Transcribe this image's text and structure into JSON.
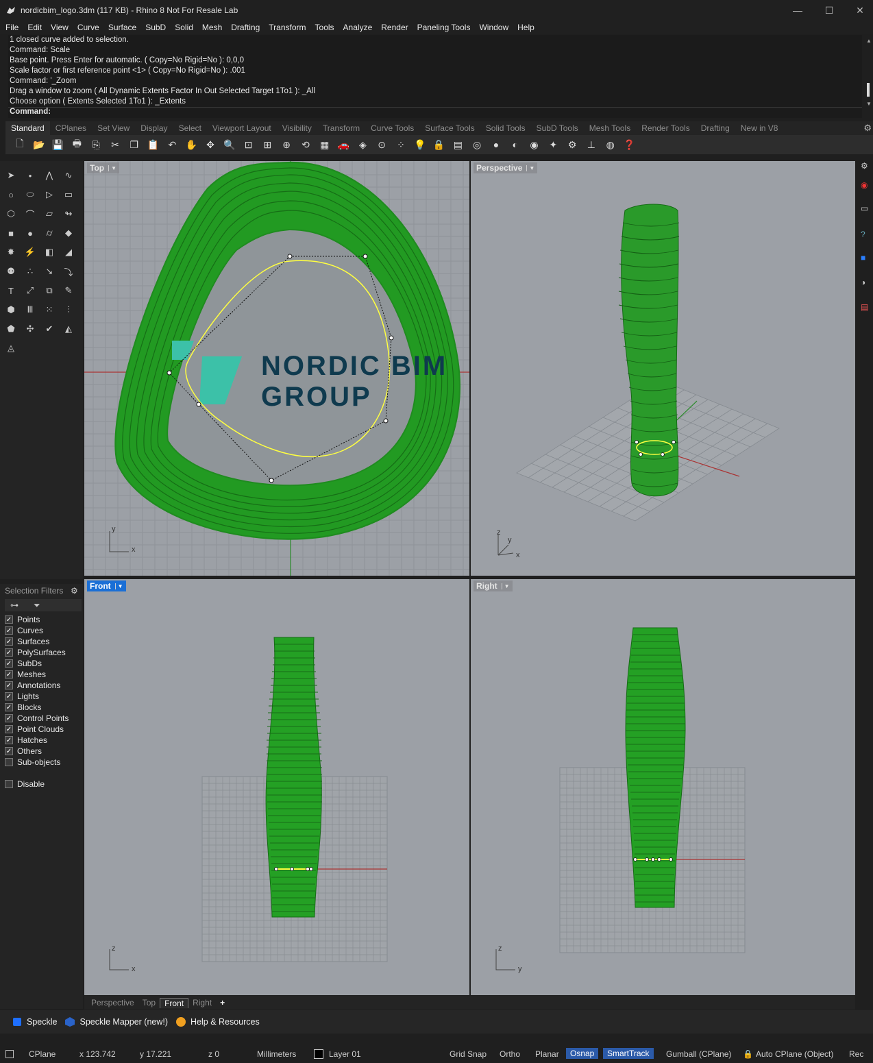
{
  "window": {
    "title": "nordicbim_logo.3dm (117 KB) - Rhino 8 Not For Resale Lab",
    "minimize": "—",
    "maximize": "☐",
    "close": "✕"
  },
  "menu": [
    "File",
    "Edit",
    "View",
    "Curve",
    "Surface",
    "SubD",
    "Solid",
    "Mesh",
    "Drafting",
    "Transform",
    "Tools",
    "Analyze",
    "Render",
    "Paneling Tools",
    "Window",
    "Help"
  ],
  "command_history": [
    "1 closed curve added to selection.",
    "Command: Scale",
    "Base point. Press Enter for automatic. ( Copy=No  Rigid=No ): 0,0,0",
    "Scale factor or first reference point <1> ( Copy=No  Rigid=No ): .001",
    "Command: '_Zoom",
    "Drag a window to zoom ( All  Dynamic  Extents  Factor  In  Out  Selected  Target  1To1 ): _All",
    "Choose option ( Extents  Selected  1To1 ): _Extents"
  ],
  "command_prompt": "Command:",
  "toolbar_tabs": [
    "Standard",
    "CPlanes",
    "Set View",
    "Display",
    "Select",
    "Viewport Layout",
    "Visibility",
    "Transform",
    "Curve Tools",
    "Surface Tools",
    "Solid Tools",
    "SubD Tools",
    "Mesh Tools",
    "Render Tools",
    "Drafting",
    "New in V8"
  ],
  "active_toolbar_tab": "Standard",
  "viewports": {
    "top": {
      "label": "Top",
      "logo_line1": "NORDIC BIM",
      "logo_line2": "GROUP"
    },
    "perspective": {
      "label": "Perspective"
    },
    "front": {
      "label": "Front"
    },
    "right": {
      "label": "Right"
    }
  },
  "axes": {
    "x": "x",
    "y": "y",
    "z": "z"
  },
  "selection_filters": {
    "title": "Selection Filters",
    "items": [
      {
        "label": "Points",
        "checked": true
      },
      {
        "label": "Curves",
        "checked": true
      },
      {
        "label": "Surfaces",
        "checked": true
      },
      {
        "label": "PolySurfaces",
        "checked": true
      },
      {
        "label": "SubDs",
        "checked": true
      },
      {
        "label": "Meshes",
        "checked": true
      },
      {
        "label": "Annotations",
        "checked": true
      },
      {
        "label": "Lights",
        "checked": true
      },
      {
        "label": "Blocks",
        "checked": true
      },
      {
        "label": "Control Points",
        "checked": true
      },
      {
        "label": "Point Clouds",
        "checked": true
      },
      {
        "label": "Hatches",
        "checked": true
      },
      {
        "label": "Others",
        "checked": true
      },
      {
        "label": "Sub-objects",
        "checked": false
      }
    ],
    "disable": {
      "label": "Disable",
      "checked": false
    }
  },
  "viewport_tabs": [
    "Perspective",
    "Top",
    "Front",
    "Right"
  ],
  "active_viewport_tab": "Front",
  "add_tab": "+",
  "panels": [
    {
      "label": "Speckle",
      "icon": "speckle-icon"
    },
    {
      "label": "Speckle Mapper (new!)",
      "icon": "speckle-mapper-icon"
    },
    {
      "label": "Help & Resources",
      "icon": "help-resources-icon"
    }
  ],
  "status": {
    "cplane": "CPlane",
    "x": "x 123.742",
    "y": "y 17.221",
    "z": "z 0",
    "units": "Millimeters",
    "layer": "Layer 01",
    "grid_snap": "Grid Snap",
    "ortho": "Ortho",
    "planar": "Planar",
    "osnap": "Osnap",
    "smarttrack": "SmartTrack",
    "gumball": "Gumball (CPlane)",
    "auto_cplane": "Auto CPlane (Object)",
    "record": "Rec"
  },
  "colors": {
    "viewport_bg": "#9ca0a6",
    "geometry_green": "#1f9a1f",
    "selected_curve": "#ffff40",
    "active_label": "#1a6fd6",
    "logo_teal": "#3cc1a8",
    "logo_navy": "#0f3a4e"
  }
}
